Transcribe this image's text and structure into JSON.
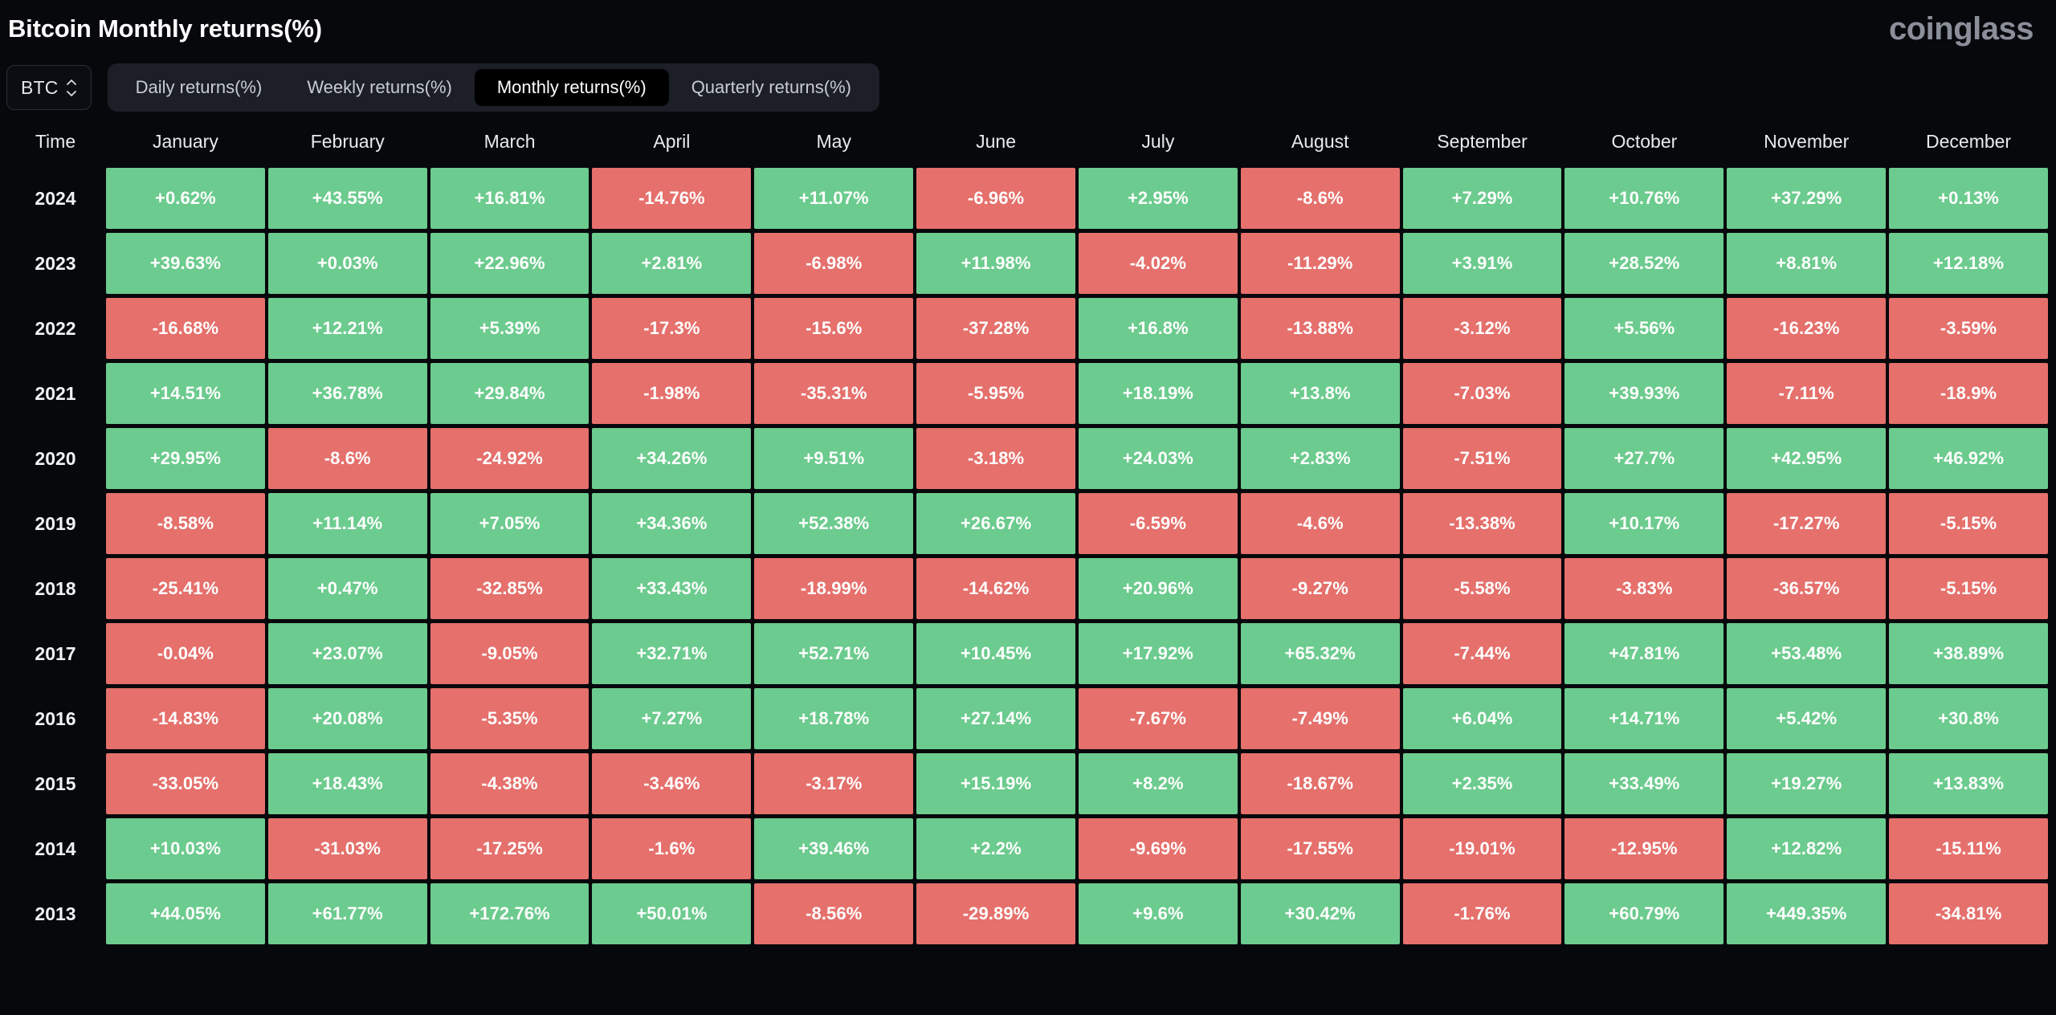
{
  "header": {
    "title": "Bitcoin Monthly returns(%)",
    "brand": "coinglass"
  },
  "toolbar": {
    "symbol": {
      "label": "BTC",
      "icon": "up-down-stepper-icon"
    },
    "tabs": [
      {
        "label": "Daily returns(%)",
        "active": false
      },
      {
        "label": "Weekly returns(%)",
        "active": false
      },
      {
        "label": "Monthly returns(%)",
        "active": true
      },
      {
        "label": "Quarterly returns(%)",
        "active": false
      }
    ]
  },
  "colors": {
    "background": "#07080c",
    "positive": "#6ccb8e",
    "negative": "#e5706c",
    "tab_bar": "#1c1f27",
    "tab_active": "#000000",
    "brand": "#8a8f99"
  },
  "chart_data": {
    "type": "heatmap",
    "title": "Bitcoin Monthly returns(%)",
    "xlabel": "",
    "ylabel": "Time",
    "columns": [
      "Time",
      "January",
      "February",
      "March",
      "April",
      "May",
      "June",
      "July",
      "August",
      "September",
      "October",
      "November",
      "December"
    ],
    "row_label_header": "Time",
    "rows": [
      {
        "year": "2024",
        "values": [
          "+0.62%",
          "+43.55%",
          "+16.81%",
          "-14.76%",
          "+11.07%",
          "-6.96%",
          "+2.95%",
          "-8.6%",
          "+7.29%",
          "+10.76%",
          "+37.29%",
          "+0.13%"
        ],
        "numeric": [
          0.62,
          43.55,
          16.81,
          -14.76,
          11.07,
          -6.96,
          2.95,
          -8.6,
          7.29,
          10.76,
          37.29,
          0.13
        ]
      },
      {
        "year": "2023",
        "values": [
          "+39.63%",
          "+0.03%",
          "+22.96%",
          "+2.81%",
          "-6.98%",
          "+11.98%",
          "-4.02%",
          "-11.29%",
          "+3.91%",
          "+28.52%",
          "+8.81%",
          "+12.18%"
        ],
        "numeric": [
          39.63,
          0.03,
          22.96,
          2.81,
          -6.98,
          11.98,
          -4.02,
          -11.29,
          3.91,
          28.52,
          8.81,
          12.18
        ]
      },
      {
        "year": "2022",
        "values": [
          "-16.68%",
          "+12.21%",
          "+5.39%",
          "-17.3%",
          "-15.6%",
          "-37.28%",
          "+16.8%",
          "-13.88%",
          "-3.12%",
          "+5.56%",
          "-16.23%",
          "-3.59%"
        ],
        "numeric": [
          -16.68,
          12.21,
          5.39,
          -17.3,
          -15.6,
          -37.28,
          16.8,
          -13.88,
          -3.12,
          5.56,
          -16.23,
          -3.59
        ]
      },
      {
        "year": "2021",
        "values": [
          "+14.51%",
          "+36.78%",
          "+29.84%",
          "-1.98%",
          "-35.31%",
          "-5.95%",
          "+18.19%",
          "+13.8%",
          "-7.03%",
          "+39.93%",
          "-7.11%",
          "-18.9%"
        ],
        "numeric": [
          14.51,
          36.78,
          29.84,
          -1.98,
          -35.31,
          -5.95,
          18.19,
          13.8,
          -7.03,
          39.93,
          -7.11,
          -18.9
        ]
      },
      {
        "year": "2020",
        "values": [
          "+29.95%",
          "-8.6%",
          "-24.92%",
          "+34.26%",
          "+9.51%",
          "-3.18%",
          "+24.03%",
          "+2.83%",
          "-7.51%",
          "+27.7%",
          "+42.95%",
          "+46.92%"
        ],
        "numeric": [
          29.95,
          -8.6,
          -24.92,
          34.26,
          9.51,
          -3.18,
          24.03,
          2.83,
          -7.51,
          27.7,
          42.95,
          46.92
        ]
      },
      {
        "year": "2019",
        "values": [
          "-8.58%",
          "+11.14%",
          "+7.05%",
          "+34.36%",
          "+52.38%",
          "+26.67%",
          "-6.59%",
          "-4.6%",
          "-13.38%",
          "+10.17%",
          "-17.27%",
          "-5.15%"
        ],
        "numeric": [
          -8.58,
          11.14,
          7.05,
          34.36,
          52.38,
          26.67,
          -6.59,
          -4.6,
          -13.38,
          10.17,
          -17.27,
          -5.15
        ]
      },
      {
        "year": "2018",
        "values": [
          "-25.41%",
          "+0.47%",
          "-32.85%",
          "+33.43%",
          "-18.99%",
          "-14.62%",
          "+20.96%",
          "-9.27%",
          "-5.58%",
          "-3.83%",
          "-36.57%",
          "-5.15%"
        ],
        "numeric": [
          -25.41,
          0.47,
          -32.85,
          33.43,
          -18.99,
          -14.62,
          20.96,
          -9.27,
          -5.58,
          -3.83,
          -36.57,
          -5.15
        ]
      },
      {
        "year": "2017",
        "values": [
          "-0.04%",
          "+23.07%",
          "-9.05%",
          "+32.71%",
          "+52.71%",
          "+10.45%",
          "+17.92%",
          "+65.32%",
          "-7.44%",
          "+47.81%",
          "+53.48%",
          "+38.89%"
        ],
        "numeric": [
          -0.04,
          23.07,
          -9.05,
          32.71,
          52.71,
          10.45,
          17.92,
          65.32,
          -7.44,
          47.81,
          53.48,
          38.89
        ]
      },
      {
        "year": "2016",
        "values": [
          "-14.83%",
          "+20.08%",
          "-5.35%",
          "+7.27%",
          "+18.78%",
          "+27.14%",
          "-7.67%",
          "-7.49%",
          "+6.04%",
          "+14.71%",
          "+5.42%",
          "+30.8%"
        ],
        "numeric": [
          -14.83,
          20.08,
          -5.35,
          7.27,
          18.78,
          27.14,
          -7.67,
          -7.49,
          6.04,
          14.71,
          5.42,
          30.8
        ]
      },
      {
        "year": "2015",
        "values": [
          "-33.05%",
          "+18.43%",
          "-4.38%",
          "-3.46%",
          "-3.17%",
          "+15.19%",
          "+8.2%",
          "-18.67%",
          "+2.35%",
          "+33.49%",
          "+19.27%",
          "+13.83%"
        ],
        "numeric": [
          -33.05,
          18.43,
          -4.38,
          -3.46,
          -3.17,
          15.19,
          8.2,
          -18.67,
          2.35,
          33.49,
          19.27,
          13.83
        ]
      },
      {
        "year": "2014",
        "values": [
          "+10.03%",
          "-31.03%",
          "-17.25%",
          "-1.6%",
          "+39.46%",
          "+2.2%",
          "-9.69%",
          "-17.55%",
          "-19.01%",
          "-12.95%",
          "+12.82%",
          "-15.11%"
        ],
        "numeric": [
          10.03,
          -31.03,
          -17.25,
          -1.6,
          39.46,
          2.2,
          -9.69,
          -17.55,
          -19.01,
          -12.95,
          12.82,
          -15.11
        ]
      },
      {
        "year": "2013",
        "values": [
          "+44.05%",
          "+61.77%",
          "+172.76%",
          "+50.01%",
          "-8.56%",
          "-29.89%",
          "+9.6%",
          "+30.42%",
          "-1.76%",
          "+60.79%",
          "+449.35%",
          "-34.81%"
        ],
        "numeric": [
          44.05,
          61.77,
          172.76,
          50.01,
          -8.56,
          -29.89,
          9.6,
          30.42,
          -1.76,
          60.79,
          449.35,
          -34.81
        ]
      }
    ]
  }
}
